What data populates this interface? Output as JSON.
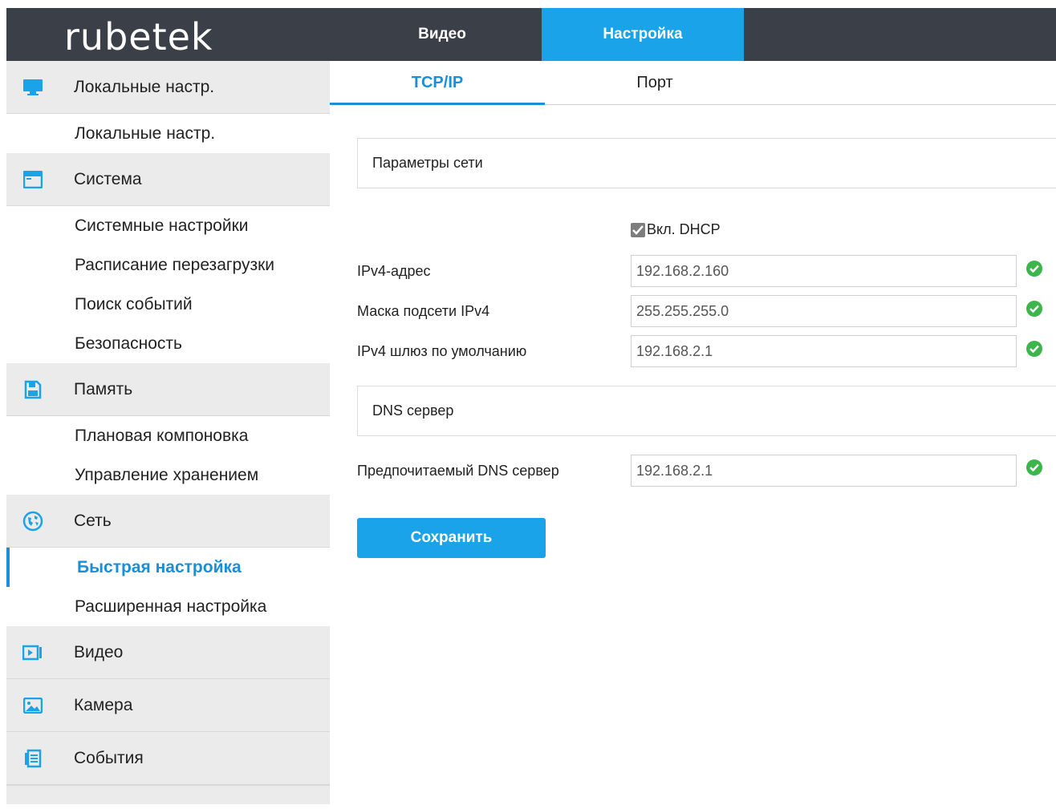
{
  "brand": {
    "logo_text": "rubetek"
  },
  "top_nav": {
    "tabs": [
      {
        "label": "Видео"
      },
      {
        "label": "Настройка",
        "active": true
      }
    ]
  },
  "sidebar": {
    "sections": [
      {
        "label": "Локальные настр.",
        "icon": "monitor-icon",
        "items": [
          "Локальные настр."
        ]
      },
      {
        "label": "Система",
        "icon": "system-icon",
        "items": [
          "Системные настройки",
          "Расписание перезагрузки",
          "Поиск событий",
          "Безопасность"
        ]
      },
      {
        "label": "Память",
        "icon": "floppy-disk-icon",
        "items": [
          "Плановая компоновка",
          "Управление хранением"
        ]
      },
      {
        "label": "Сеть",
        "icon": "globe-icon",
        "items": [
          "Быстрая настройка",
          "Расширенная настройка"
        ],
        "active_item": "Быстрая настройка"
      },
      {
        "label": "Видео",
        "icon": "video-icon",
        "items": []
      },
      {
        "label": "Камера",
        "icon": "image-icon",
        "items": []
      },
      {
        "label": "События",
        "icon": "events-icon",
        "items": []
      }
    ]
  },
  "subtabs": [
    {
      "label": "TCP/IP",
      "active": true
    },
    {
      "label": "Порт"
    }
  ],
  "network": {
    "section_title": "Параметры сети",
    "dhcp_label": "Вкл. DHCP",
    "dhcp_checked": true,
    "ipv4_address_label": "IPv4-адрес",
    "ipv4_address_value": "192.168.2.160",
    "subnet_mask_label": "Маска подсети IPv4",
    "subnet_mask_value": "255.255.255.0",
    "gateway_label": "IPv4 шлюз по умолчанию",
    "gateway_value": "192.168.2.1"
  },
  "dns": {
    "section_title": "DNS сервер",
    "preferred_label": "Предпочитаемый DNS сервер",
    "preferred_value": "192.168.2.1"
  },
  "actions": {
    "save_label": "Сохранить"
  },
  "colors": {
    "accent": "#1aa3e8",
    "topbar": "#3a3f48",
    "valid": "#3cb54a"
  }
}
